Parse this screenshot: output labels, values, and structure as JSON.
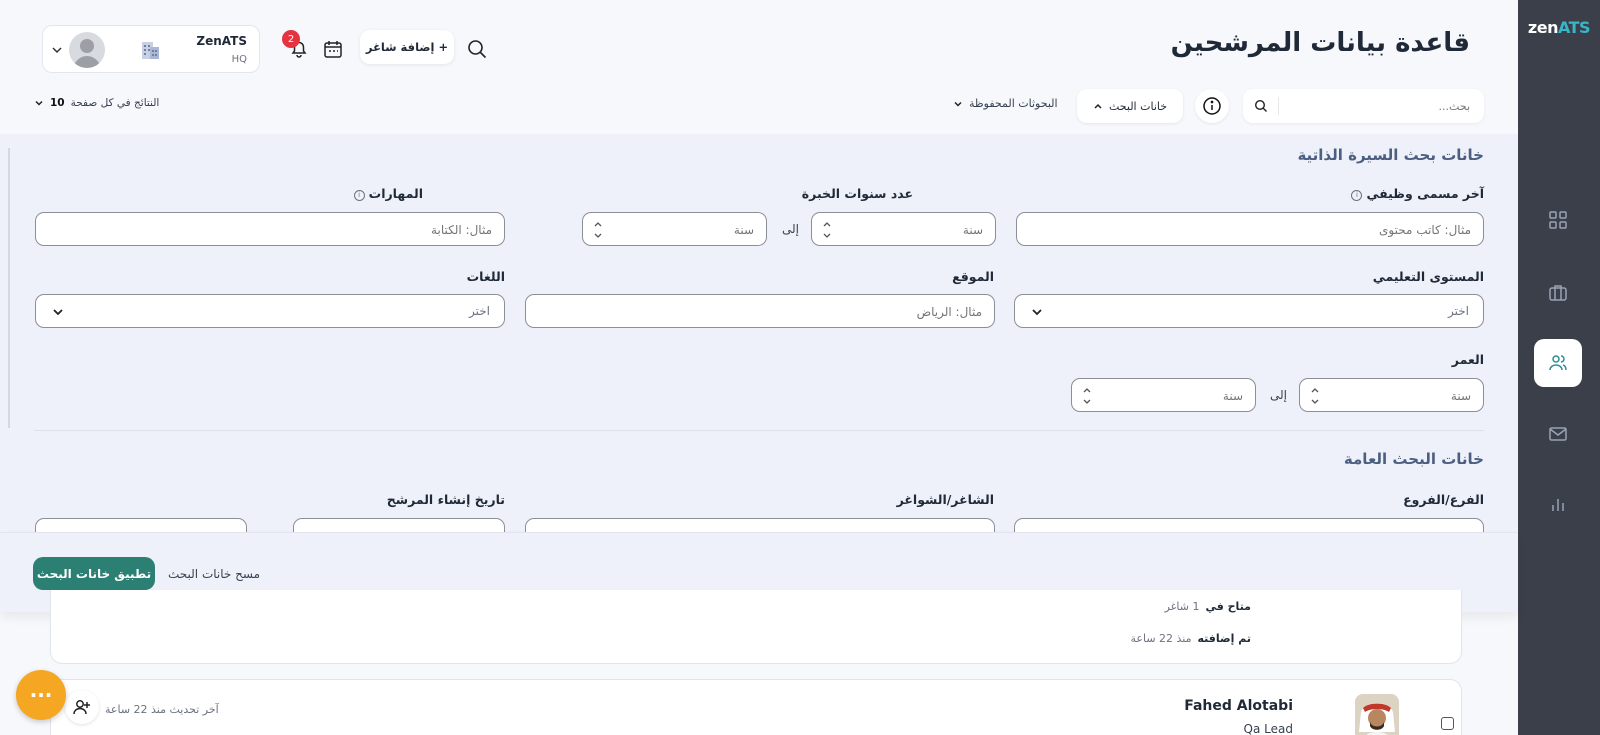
{
  "app": {
    "logo_main": "zen",
    "logo_accent": "ATS"
  },
  "header": {
    "title": "قاعدة بيانات المرشحين",
    "add_job_label": "+ إضافة شاغر",
    "notification_count": "2",
    "company_name": "ZenATS",
    "company_sub": "HQ"
  },
  "search": {
    "placeholder": "بحث...",
    "filters_toggle": "خانات البحث",
    "saved_searches": "البحوثات المحفوظة",
    "per_page_label": "النتائج في كل صفحة",
    "per_page_value": "10"
  },
  "cv_section": {
    "title": "خانات بحث السيرة الذاتية",
    "last_title_label": "آخر مسمى وظيفي",
    "last_title_placeholder": "مثال: كاتب محتوى",
    "experience_label": "عدد سنوات الخبرة",
    "year_placeholder": "سنة",
    "to_word": "إلى",
    "skills_label": "المهارات",
    "skills_placeholder": "مثال: الكتابة",
    "education_label": "المستوى التعليمي",
    "select_placeholder": "اختر",
    "location_label": "الموقع",
    "location_placeholder": "مثال: الرياض",
    "languages_label": "اللغات",
    "age_label": "العمر"
  },
  "general_section": {
    "title": "خانات البحث العامة",
    "branches_label": "الفرع/الفروع",
    "jobs_label": "الشاغر/الشواغر",
    "created_date_label": "تاريخ إنشاء المرشح"
  },
  "footer": {
    "apply_label": "تطبيق خانات البحث",
    "clear_label": "مسح خانات البحث"
  },
  "candidates": [
    {
      "available_key": "متاح في",
      "available_value": "1 شاغر",
      "added_key": "تم إضافته",
      "added_value": "منذ 22 ساعة"
    },
    {
      "name": "Fahed Alotabi",
      "role": "Qa Lead",
      "updated": "آخر تحديث منذ 22 ساعة"
    }
  ],
  "fab_label": "···"
}
